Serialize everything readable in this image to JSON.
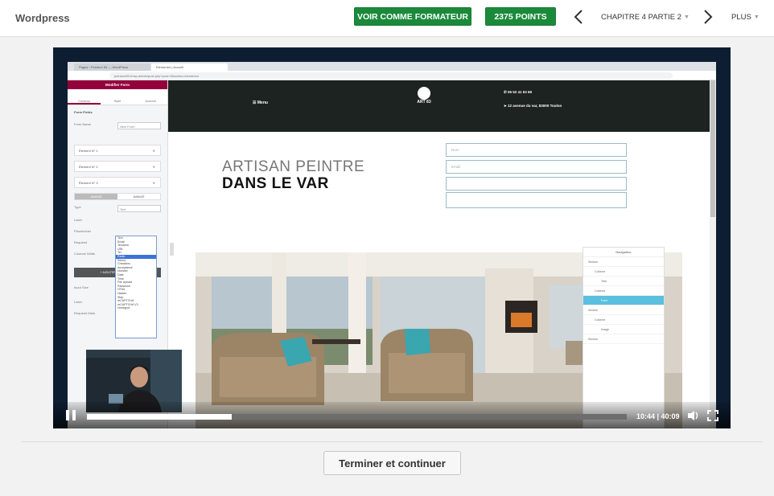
{
  "header": {
    "brand": "Wordpress",
    "formateur_label": "VOIR COMME FORMATEUR",
    "points_label": "2375 POINTS",
    "chapter_label": "CHAPITRE 4 PARTIE 2",
    "more_label": "PLUS"
  },
  "player": {
    "progress_fraction": 0.268,
    "time": "10:44 | 40:09"
  },
  "video": {
    "browser_tabs": [
      "Pages ‹ Peinture 83 — WordPress",
      "Elementor | Accueil"
    ],
    "url": "peinture83.fr/wp-admin/post.php?post=5&action=elementor",
    "editor": {
      "title": "Modifier Form",
      "tabs": [
        "Contenu",
        "Style",
        "Avancé"
      ],
      "section": "Form Fields",
      "form_name_label": "Form Name",
      "form_name_value": "New Form",
      "items": [
        "Élément N° 1",
        "Élément N° 2",
        "Élément N° 3"
      ],
      "content_tab": "AVANCÉ",
      "advanced_tab": "AVANCÉ",
      "type_label": "Type",
      "type_value": "Text",
      "field_labels": [
        "Label",
        "Placeholder",
        "Required",
        "Colonne Width"
      ],
      "options": [
        "Text",
        "Email",
        "Textarea",
        "URL",
        "Tel",
        "Radio",
        "Select",
        "Checkbox",
        "Acceptance",
        "Number",
        "Date",
        "Time",
        "File Upload",
        "Password",
        "HTML",
        "Hidden",
        "Step",
        "reCAPTCHA",
        "reCAPTCHA V3",
        "Honeypot"
      ],
      "selected_option": "Radio",
      "add_button": "+ AJOUTER UN ÉLÉMENT",
      "input_size_label": "Input Size",
      "label_label": "Label",
      "required_mark_label": "Required Mark"
    },
    "site": {
      "menu": "Menu",
      "logo_text": "ART 83",
      "phone": "06 52 41 53 69",
      "address": "12 avenue du var, 83000 Toulon",
      "hero_line1": "ARTISAN PEINTRE",
      "hero_line2": "DANS LE VAR",
      "field_name": "Nom",
      "field_email": "Email"
    },
    "navigator": {
      "title": "Navigateur",
      "rows": [
        "Section",
        "Colonne",
        "Titre",
        "Colonne",
        "Form",
        "Section",
        "Colonne",
        "Image",
        "Section"
      ],
      "selected": "Form"
    }
  },
  "footer": {
    "finish_label": "Terminer et continuer"
  },
  "colors": {
    "green": "#1a8a3a",
    "editor_brand": "#93003c",
    "player_bg": "#0d1e33"
  }
}
